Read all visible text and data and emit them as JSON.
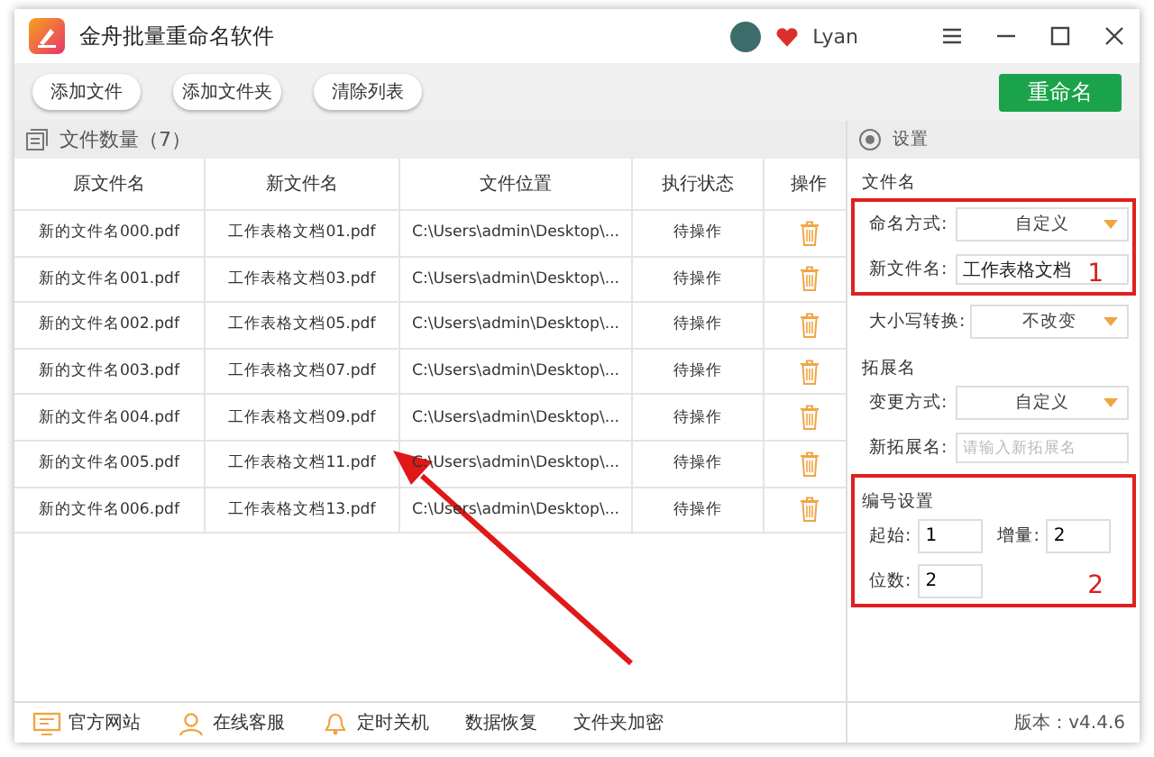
{
  "window": {
    "title": "金舟批量重命名软件",
    "user": "Lyan"
  },
  "toolbar": {
    "buttons": [
      "添加文件",
      "添加文件夹",
      "清除列表"
    ],
    "primary": "重命名"
  },
  "file_list": {
    "title": "文件数量（7）",
    "columns": [
      "原文件名",
      "新文件名",
      "文件位置",
      "执行状态",
      "操作"
    ],
    "rows": [
      {
        "original": "新的文件名000.pdf",
        "renamed": "工作表格文档01.pdf",
        "location": "C:\\Users\\admin\\Desktop\\...",
        "status": "待操作"
      },
      {
        "original": "新的文件名001.pdf",
        "renamed": "工作表格文档03.pdf",
        "location": "C:\\Users\\admin\\Desktop\\...",
        "status": "待操作"
      },
      {
        "original": "新的文件名002.pdf",
        "renamed": "工作表格文档05.pdf",
        "location": "C:\\Users\\admin\\Desktop\\...",
        "status": "待操作"
      },
      {
        "original": "新的文件名003.pdf",
        "renamed": "工作表格文档07.pdf",
        "location": "C:\\Users\\admin\\Desktop\\...",
        "status": "待操作"
      },
      {
        "original": "新的文件名004.pdf",
        "renamed": "工作表格文档09.pdf",
        "location": "C:\\Users\\admin\\Desktop\\...",
        "status": "待操作"
      },
      {
        "original": "新的文件名005.pdf",
        "renamed": "工作表格文档11.pdf",
        "location": "C:\\Users\\admin\\Desktop\\...",
        "status": "待操作"
      },
      {
        "original": "新的文件名006.pdf",
        "renamed": "工作表格文档13.pdf",
        "location": "C:\\Users\\admin\\Desktop\\...",
        "status": "待操作"
      }
    ]
  },
  "settings": {
    "title": "设置",
    "blocks": [
      {
        "kind": "heading",
        "text": "文件名"
      },
      {
        "kind": "boxed",
        "mark": "1",
        "rows": [
          {
            "kind": "select",
            "label": "命名方式:",
            "value": "自定义"
          },
          {
            "kind": "input",
            "label": "新文件名:",
            "value": "工作表格文档"
          }
        ]
      },
      {
        "kind": "select",
        "label": "大小写转换:",
        "value": "不改变"
      },
      {
        "kind": "heading",
        "text": "拓展名"
      },
      {
        "kind": "select",
        "label": "变更方式:",
        "value": "自定义"
      },
      {
        "kind": "input",
        "label": "新拓展名:",
        "placeholder": "请输入新拓展名"
      },
      {
        "kind": "boxed",
        "mark": "2",
        "heading": "编号设置",
        "rows": [
          {
            "kind": "pair",
            "items": [
              {
                "label": "起始:",
                "value": "1"
              },
              {
                "label": "增量:",
                "value": "2"
              }
            ]
          },
          {
            "kind": "pair",
            "items": [
              {
                "label": "位数:",
                "value": "2"
              }
            ]
          }
        ]
      }
    ]
  },
  "footer": {
    "links": [
      {
        "kind": "monitor",
        "text": "官方网站"
      },
      {
        "kind": "person",
        "text": "在线客服"
      },
      {
        "kind": "bell",
        "text": "定时关机"
      },
      {
        "kind": "plain",
        "text": "数据恢复"
      },
      {
        "kind": "plain",
        "text": "文件夹加密"
      }
    ],
    "version": "版本：v4.4.6"
  }
}
